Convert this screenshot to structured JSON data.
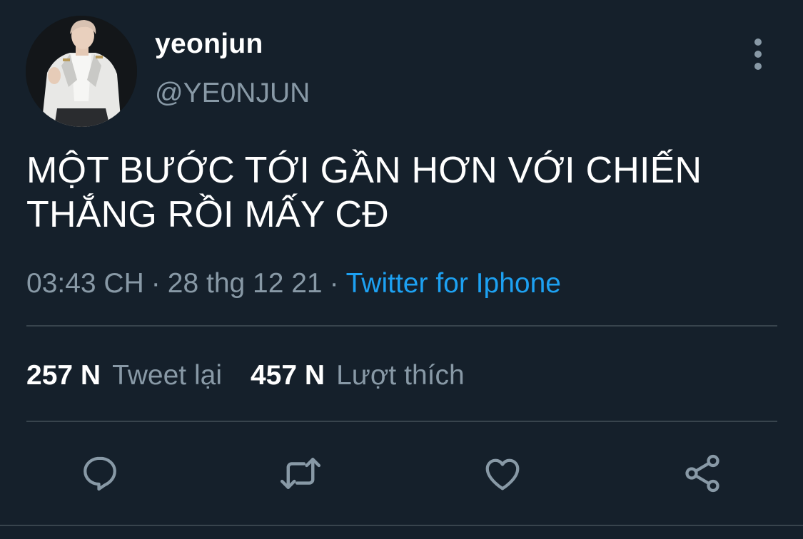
{
  "user": {
    "display_name": "yeonjun",
    "handle": "@YE0NJUN"
  },
  "tweet": {
    "text": "MỘT BƯỚC TỚI GẦN HƠN VỚI CHIẾN THẮNG RỒI MẤY CĐ",
    "time": "03:43 CH",
    "separator_1": "·",
    "date": "28 thg 12 21",
    "separator_2": "·",
    "source": "Twitter for Iphone"
  },
  "stats": {
    "retweets_count": "257 N",
    "retweets_label": "Tweet lại",
    "likes_count": "457 N",
    "likes_label": "Lượt thích"
  },
  "actions": [
    {
      "icon": "reply-icon"
    },
    {
      "icon": "retweet-icon"
    },
    {
      "icon": "heart-icon"
    },
    {
      "icon": "share-icon"
    }
  ],
  "colors": {
    "background": "#15202b",
    "secondary_text": "#8899a6",
    "link": "#1da1f2",
    "divider": "#38444d"
  }
}
